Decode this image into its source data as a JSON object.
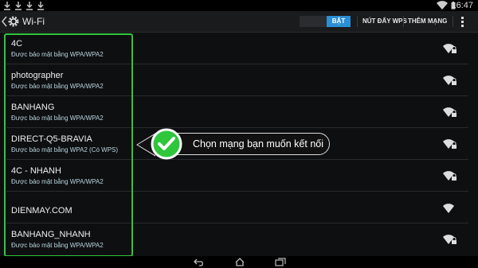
{
  "status_bar": {
    "time": "16:47",
    "notification_icons": [
      "download-icon",
      "download-icon",
      "download-icon",
      "download-icon"
    ]
  },
  "action_bar": {
    "title": "Wi-Fi",
    "toggle_label": "BẬT",
    "wps_button": "NÚT ĐẨY WPS",
    "add_network_button": "THÊM MẠNG"
  },
  "networks": [
    {
      "ssid": "4C",
      "security": "Được bảo mật bằng WPA/WPA2",
      "locked": true
    },
    {
      "ssid": "photographer",
      "security": "Được bảo mật bằng WPA/WPA2",
      "locked": true
    },
    {
      "ssid": "BANHANG",
      "security": "Được bảo mật bằng WPA/WPA2",
      "locked": true
    },
    {
      "ssid": "DIRECT-Q5-BRAVIA",
      "security": "Được bảo mật bằng WPA2 (Có WPS)",
      "locked": true
    },
    {
      "ssid": "4C - NHANH",
      "security": "Được bảo mật bằng WPA/WPA2",
      "locked": true
    },
    {
      "ssid": "DIENMAY.COM",
      "security": "",
      "locked": false
    },
    {
      "ssid": "BANHANG_NHANH",
      "security": "Được bảo mật bằng WPA/WPA2",
      "locked": true
    }
  ],
  "callout": {
    "text": "Chọn mạng bạn muốn kết nối"
  },
  "colors": {
    "highlight": "#2ec63b",
    "toggle_on": "#2a8fd6",
    "security_text": "#b8d4e0"
  }
}
